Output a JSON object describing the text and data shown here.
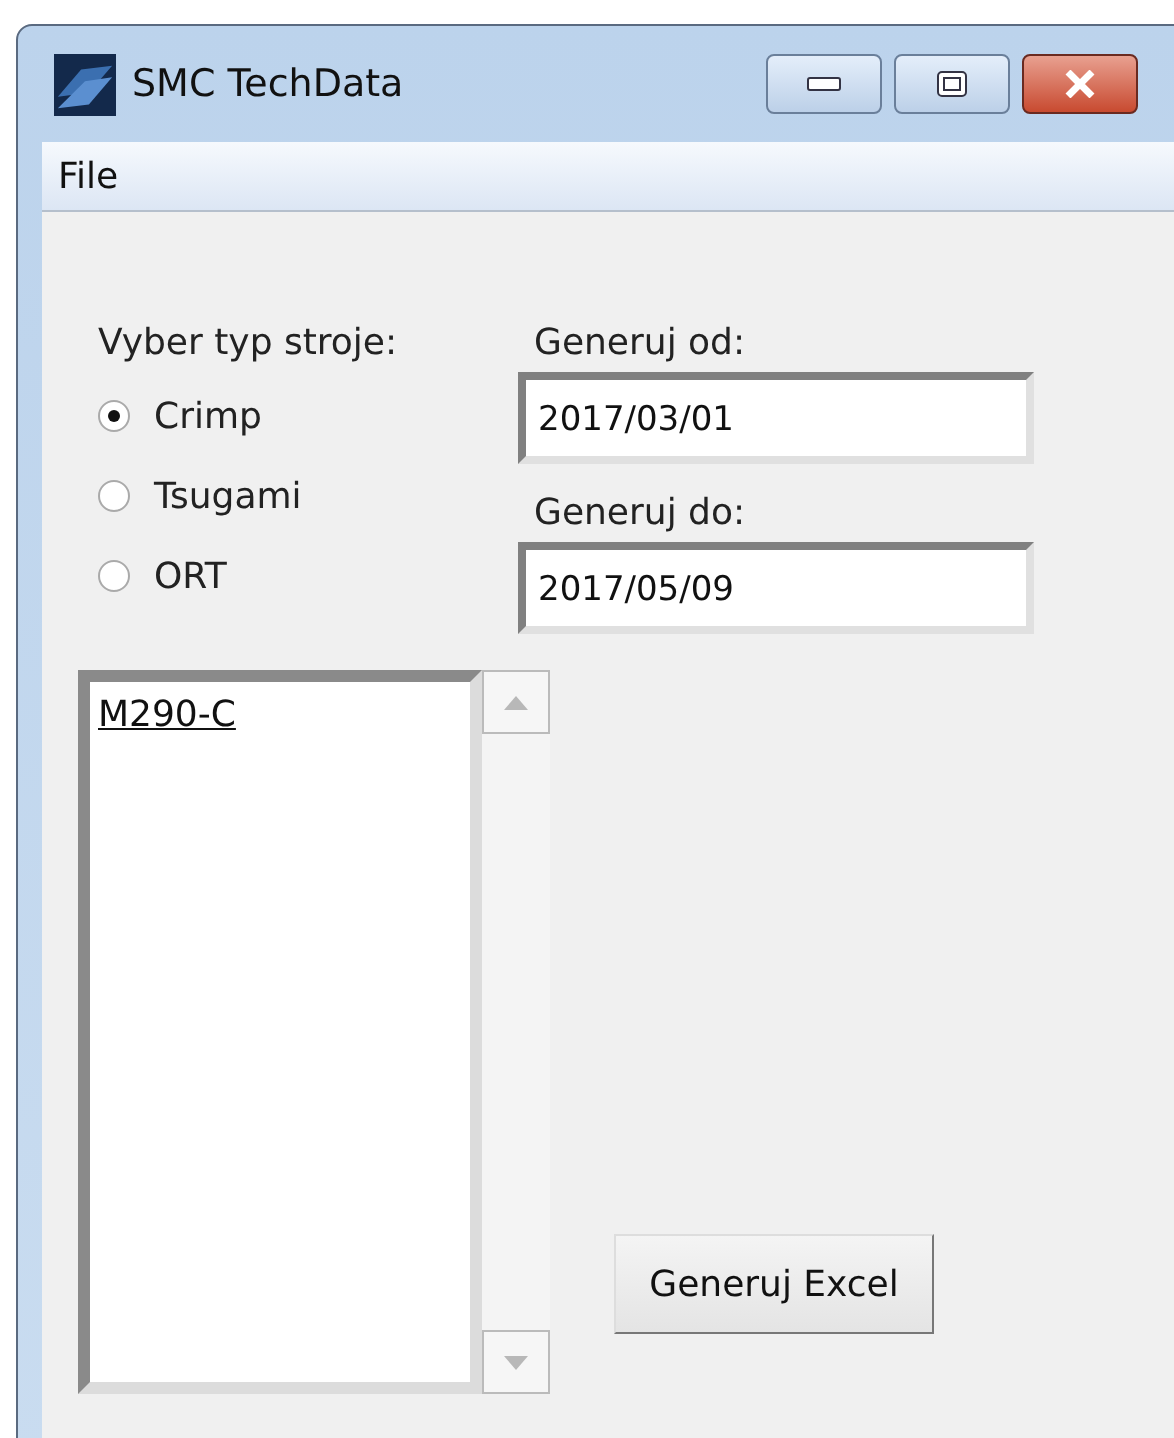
{
  "window": {
    "title": "SMC TechData"
  },
  "menu": [
    "File"
  ],
  "machine_type": {
    "label": "Vyber typ stroje:",
    "options": [
      {
        "label": "Crimp",
        "selected": true
      },
      {
        "label": "Tsugami",
        "selected": false
      },
      {
        "label": "ORT",
        "selected": false
      }
    ]
  },
  "date_from": {
    "label": "Generuj od:",
    "value": "2017/03/01"
  },
  "date_to": {
    "label": "Generuj do:",
    "value": "2017/05/09"
  },
  "list": {
    "items": [
      "M290-C"
    ]
  },
  "buttons": [
    "Generuj Excel"
  ]
}
